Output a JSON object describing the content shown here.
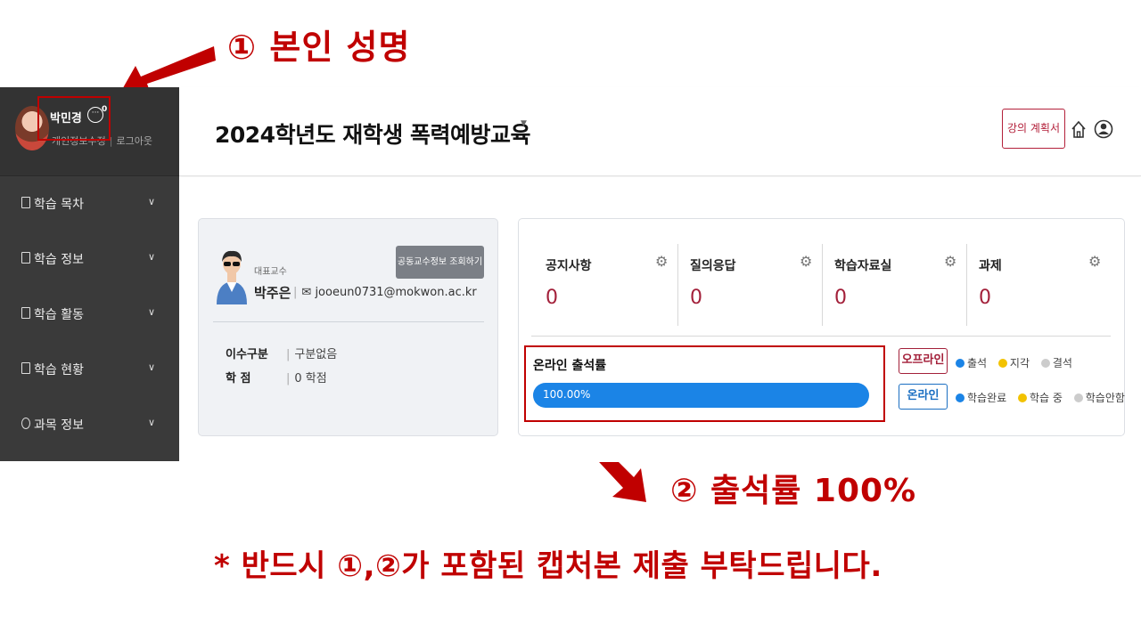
{
  "annotations": {
    "step1": "① 본인 성명",
    "step2": "② 출석률 100%",
    "note": "* 반드시 ①,②가 포함된 캡처본 제출 부탁드립니다."
  },
  "sidebar": {
    "user_name": "박민경",
    "message_count": "0",
    "edit_profile": "개인정보수정",
    "logout": "로그아웃",
    "items": [
      {
        "label": "학습 목차"
      },
      {
        "label": "학습 정보"
      },
      {
        "label": "학습 활동"
      },
      {
        "label": "학습 현황"
      },
      {
        "label": "과목 정보"
      }
    ]
  },
  "header": {
    "course_title": "2024학년도 재학생 폭력예방교육",
    "syllabus_label": "강의 계획서"
  },
  "professor": {
    "role": "대표교수",
    "name": "박주은",
    "email": "jooeun0731@mokwon.ac.kr",
    "coprof_button": "공동교수정보 조회하기",
    "info": [
      {
        "label": "이수구분",
        "value": "구분없음"
      },
      {
        "label": "학 점",
        "value": "0 학점"
      }
    ]
  },
  "stats": [
    {
      "label": "공지사항",
      "value": "0"
    },
    {
      "label": "질의응답",
      "value": "0"
    },
    {
      "label": "학습자료실",
      "value": "0"
    },
    {
      "label": "과제",
      "value": "0"
    }
  ],
  "attendance": {
    "title": "온라인 출석률",
    "rate_text": "100.00%",
    "rate": 1.0
  },
  "legend": {
    "offline_tag": "오프라인",
    "online_tag": "온라인",
    "offline_items": [
      {
        "label": "출석",
        "color": "#1b84e6"
      },
      {
        "label": "지각",
        "color": "#f2c200"
      },
      {
        "label": "결석",
        "color": "#cccccc"
      }
    ],
    "online_items": [
      {
        "label": "학습완료",
        "color": "#1b84e6"
      },
      {
        "label": "학습 중",
        "color": "#f2c200"
      },
      {
        "label": "학습안함",
        "color": "#cccccc"
      }
    ]
  },
  "colors": {
    "annotation_red": "#c00000",
    "accent_red": "#a3203a",
    "progress_blue": "#1b84e6"
  }
}
